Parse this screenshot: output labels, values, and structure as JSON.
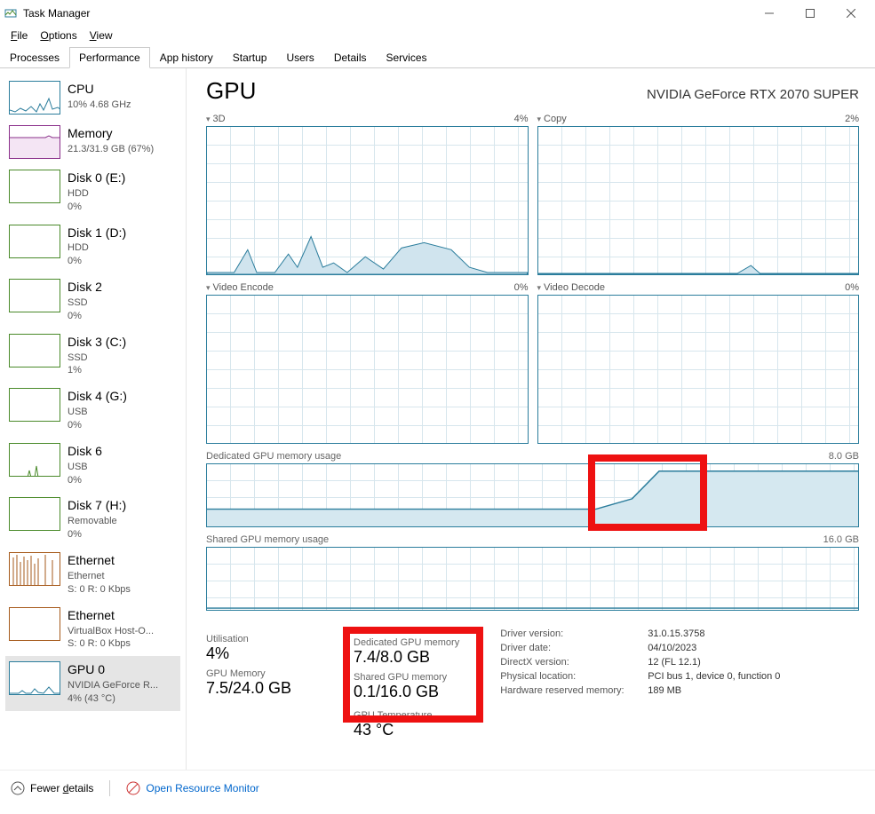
{
  "window": {
    "title": "Task Manager"
  },
  "menu": {
    "file": "File",
    "options": "Options",
    "view": "View"
  },
  "tabs": [
    "Processes",
    "Performance",
    "App history",
    "Startup",
    "Users",
    "Details",
    "Services"
  ],
  "active_tab": "Performance",
  "sidebar": {
    "items": [
      {
        "name": "CPU",
        "sub": "10% 4.68 GHz",
        "color": "#2b7d9c"
      },
      {
        "name": "Memory",
        "sub": "21.3/31.9 GB (67%)",
        "color": "#8a2f8a"
      },
      {
        "name": "Disk 0 (E:)",
        "sub": "HDD",
        "sub2": "0%",
        "color": "#4a8a2a"
      },
      {
        "name": "Disk 1 (D:)",
        "sub": "HDD",
        "sub2": "0%",
        "color": "#4a8a2a"
      },
      {
        "name": "Disk 2",
        "sub": "SSD",
        "sub2": "0%",
        "color": "#4a8a2a"
      },
      {
        "name": "Disk 3 (C:)",
        "sub": "SSD",
        "sub2": "1%",
        "color": "#4a8a2a"
      },
      {
        "name": "Disk 4 (G:)",
        "sub": "USB",
        "sub2": "0%",
        "color": "#4a8a2a"
      },
      {
        "name": "Disk 6",
        "sub": "USB",
        "sub2": "0%",
        "color": "#4a8a2a"
      },
      {
        "name": "Disk 7 (H:)",
        "sub": "Removable",
        "sub2": "0%",
        "color": "#4a8a2a"
      },
      {
        "name": "Ethernet",
        "sub": "Ethernet",
        "sub2": "S: 0  R: 0 Kbps",
        "color": "#a65a1b"
      },
      {
        "name": "Ethernet",
        "sub": "VirtualBox Host-O...",
        "sub2": "S: 0  R: 0 Kbps",
        "color": "#a65a1b"
      },
      {
        "name": "GPU 0",
        "sub": "NVIDIA GeForce R...",
        "sub2": "4%  (43 °C)",
        "color": "#2b7d9c",
        "selected": true
      }
    ]
  },
  "main": {
    "title": "GPU",
    "device": "NVIDIA GeForce RTX 2070 SUPER",
    "charts_top": [
      {
        "name": "3D",
        "value": "4%"
      },
      {
        "name": "Copy",
        "value": "2%"
      },
      {
        "name": "Video Encode",
        "value": "0%"
      },
      {
        "name": "Video Decode",
        "value": "0%"
      }
    ],
    "mem_charts": [
      {
        "name": "Dedicated GPU memory usage",
        "max": "8.0 GB"
      },
      {
        "name": "Shared GPU memory usage",
        "max": "16.0 GB"
      }
    ],
    "stats": {
      "utilisation_label": "Utilisation",
      "utilisation": "4%",
      "gpu_memory_label": "GPU Memory",
      "gpu_memory": "7.5/24.0 GB",
      "dedicated_label": "Dedicated GPU memory",
      "dedicated": "7.4/8.0 GB",
      "shared_label": "Shared GPU memory",
      "shared": "0.1/16.0 GB",
      "temp_label": "GPU Temperature",
      "temp": "43 °C"
    },
    "details": {
      "driver_version_l": "Driver version:",
      "driver_version": "31.0.15.3758",
      "driver_date_l": "Driver date:",
      "driver_date": "04/10/2023",
      "directx_l": "DirectX version:",
      "directx": "12 (FL 12.1)",
      "location_l": "Physical location:",
      "location": "PCI bus 1, device 0, function 0",
      "hwmem_l": "Hardware reserved memory:",
      "hwmem": "189 MB"
    }
  },
  "footer": {
    "fewer": "Fewer details",
    "orm": "Open Resource Monitor"
  }
}
